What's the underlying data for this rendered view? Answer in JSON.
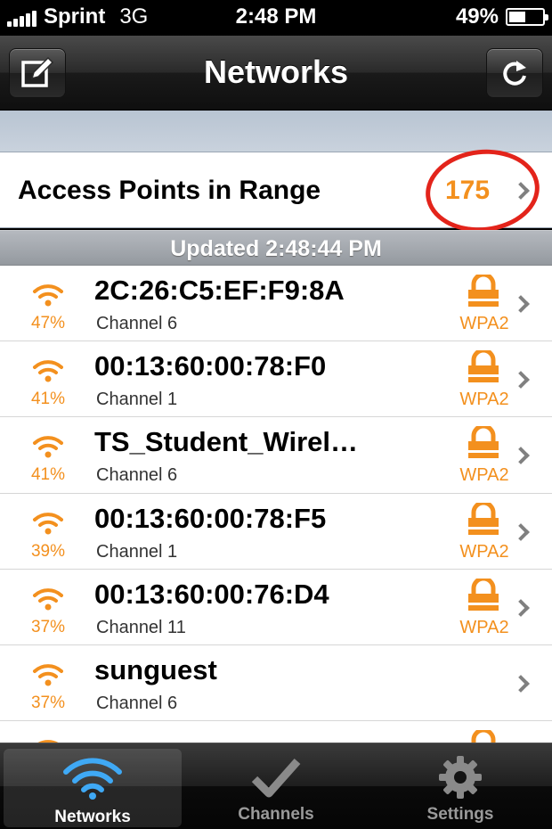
{
  "status_bar": {
    "carrier": "Sprint",
    "network": "3G",
    "time": "2:48 PM",
    "battery": "49%",
    "battery_level": 0.49
  },
  "nav": {
    "title": "Networks",
    "left_icon": "edit-icon",
    "right_icon": "refresh-icon"
  },
  "access_points": {
    "label": "Access Points in Range",
    "count": "175"
  },
  "updated": "Updated 2:48:44 PM",
  "networks": [
    {
      "ssid": "2C:26:C5:EF:F9:8A",
      "channel": "Channel 6",
      "signal": "47%",
      "security": "WPA2"
    },
    {
      "ssid": "00:13:60:00:78:F0",
      "channel": "Channel 1",
      "signal": "41%",
      "security": "WPA2"
    },
    {
      "ssid": "TS_Student_Wirel…",
      "channel": "Channel 6",
      "signal": "41%",
      "security": "WPA2"
    },
    {
      "ssid": "00:13:60:00:78:F5",
      "channel": "Channel 1",
      "signal": "39%",
      "security": "WPA2"
    },
    {
      "ssid": "00:13:60:00:76:D4",
      "channel": "Channel 11",
      "signal": "37%",
      "security": "WPA2"
    },
    {
      "ssid": "sunguest",
      "channel": "Channel 6",
      "signal": "37%",
      "security": ""
    }
  ],
  "tabs": [
    {
      "label": "Networks",
      "icon": "wifi-icon",
      "selected": true
    },
    {
      "label": "Channels",
      "icon": "checkmark-icon",
      "selected": false
    },
    {
      "label": "Settings",
      "icon": "gear-icon",
      "selected": false
    }
  ],
  "colors": {
    "accent": "#f3901e",
    "annotation": "#e3241b",
    "tab_selected_icon": "#3fa9f5"
  }
}
